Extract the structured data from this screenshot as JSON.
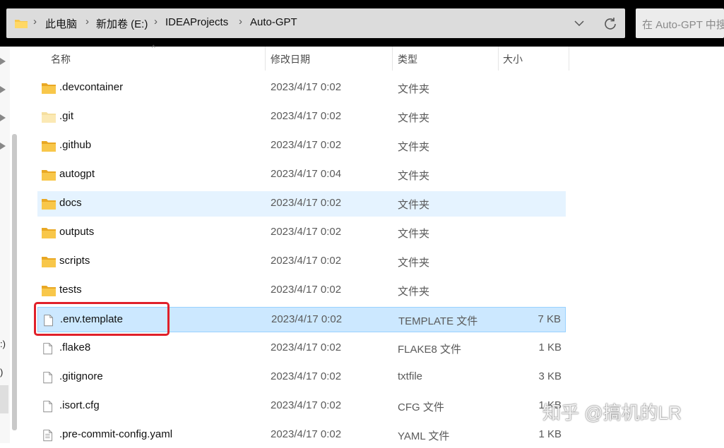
{
  "address_bar": {
    "crumbs": [
      "此电脑",
      "新加卷 (E:)",
      "IDEAProjects",
      "Auto-GPT"
    ],
    "separator": ">"
  },
  "search": {
    "placeholder": "在 Auto-GPT 中搜"
  },
  "left_pane": {
    "partial_labels": [
      ":)",
      ")"
    ]
  },
  "columns": {
    "name": "名称",
    "date": "修改日期",
    "type": "类型",
    "size": "大小"
  },
  "sort_indicator": "^",
  "files": [
    {
      "name": ".devcontainer",
      "date": "2023/4/17 0:02",
      "type": "文件夹",
      "size": "",
      "icon": "folder-icon"
    },
    {
      "name": ".git",
      "date": "2023/4/17 0:02",
      "type": "文件夹",
      "size": "",
      "icon": "folder-hidden-icon"
    },
    {
      "name": ".github",
      "date": "2023/4/17 0:02",
      "type": "文件夹",
      "size": "",
      "icon": "folder-icon"
    },
    {
      "name": "autogpt",
      "date": "2023/4/17 0:04",
      "type": "文件夹",
      "size": "",
      "icon": "folder-icon"
    },
    {
      "name": "docs",
      "date": "2023/4/17 0:02",
      "type": "文件夹",
      "size": "",
      "icon": "folder-icon",
      "state": "hover"
    },
    {
      "name": "outputs",
      "date": "2023/4/17 0:02",
      "type": "文件夹",
      "size": "",
      "icon": "folder-icon"
    },
    {
      "name": "scripts",
      "date": "2023/4/17 0:02",
      "type": "文件夹",
      "size": "",
      "icon": "folder-icon"
    },
    {
      "name": "tests",
      "date": "2023/4/17 0:02",
      "type": "文件夹",
      "size": "",
      "icon": "folder-icon"
    },
    {
      "name": ".env.template",
      "date": "2023/4/17 0:02",
      "type": "TEMPLATE 文件",
      "size": "7 KB",
      "icon": "file-icon",
      "state": "selected"
    },
    {
      "name": ".flake8",
      "date": "2023/4/17 0:02",
      "type": "FLAKE8 文件",
      "size": "1 KB",
      "icon": "file-icon"
    },
    {
      "name": ".gitignore",
      "date": "2023/4/17 0:02",
      "type": "txtfile",
      "size": "3 KB",
      "icon": "file-icon"
    },
    {
      "name": ".isort.cfg",
      "date": "2023/4/17 0:02",
      "type": "CFG 文件",
      "size": "1 KB",
      "icon": "file-icon"
    },
    {
      "name": ".pre-commit-config.yaml",
      "date": "2023/4/17 0:02",
      "type": "YAML 文件",
      "size": "1 KB",
      "icon": "text-file-icon"
    }
  ],
  "watermark": "知乎 @搞机的LR",
  "colors": {
    "selected_bg": "#cce8ff",
    "hover_bg": "#e5f3ff",
    "folder": "#f8c74a",
    "highlight_box": "#e0202a"
  }
}
